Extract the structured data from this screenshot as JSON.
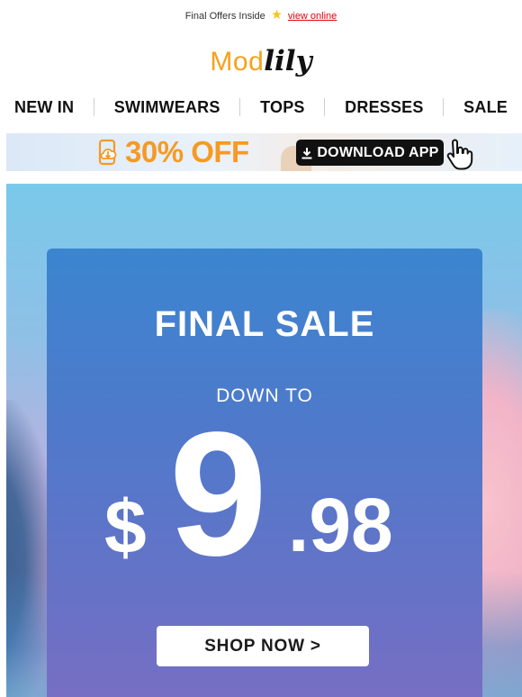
{
  "preheader": {
    "text": "Final Offers Inside",
    "link": "view online",
    "star_icon": "star-icon"
  },
  "logo": {
    "part1": "Mod",
    "part2": "lily"
  },
  "nav": [
    {
      "label": "NEW IN"
    },
    {
      "label": "SWIMWEARS"
    },
    {
      "label": "TOPS"
    },
    {
      "label": "DRESSES"
    },
    {
      "label": "SALE"
    }
  ],
  "app_banner": {
    "offer": "30% OFF",
    "button": "DOWNLOAD APP",
    "accent": "#f59a23"
  },
  "hero": {
    "title": "FINAL SALE",
    "subtitle": "DOWN TO",
    "price": {
      "currency": "$",
      "integer": "9",
      "decimal": ".98"
    },
    "cta": "SHOP NOW >"
  },
  "colors": {
    "link": "#e60012",
    "brand_orange": "#f5a21a",
    "button_bg": "#111111"
  }
}
